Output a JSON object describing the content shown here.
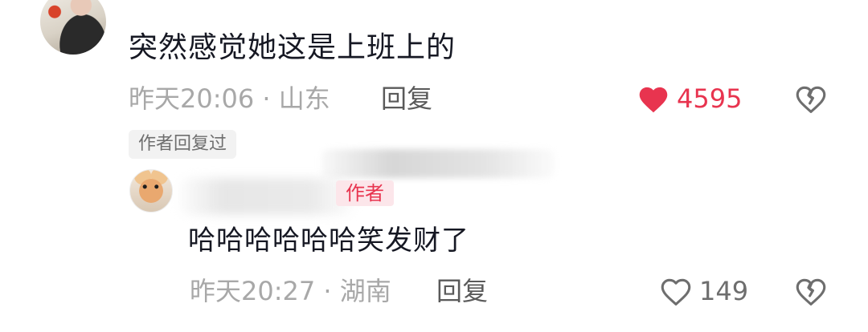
{
  "comment": {
    "text": "突然感觉她这是上班上的",
    "time_location": "昨天20:06 · 山东",
    "reply_label": "回复",
    "like_count": "4595",
    "author_replied_tag": "作者回复过"
  },
  "reply": {
    "author_badge": "作者",
    "text": "哈哈哈哈哈哈笑发财了",
    "time_location": "昨天20:27 · 湖南",
    "reply_label": "回复",
    "like_count": "149"
  },
  "colors": {
    "like_active": "#e8344f",
    "text_primary": "#161823",
    "text_meta": "#a8a8a8"
  },
  "icons": {
    "like_active": "heart-filled-icon",
    "like_inactive": "heart-outline-icon",
    "dislike": "broken-heart-icon"
  }
}
